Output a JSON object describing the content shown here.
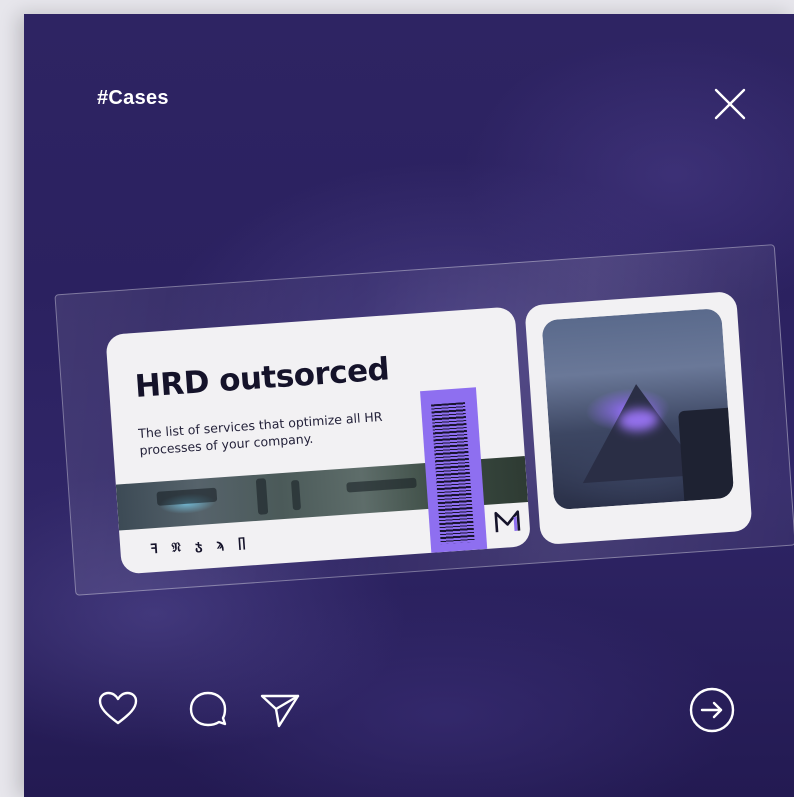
{
  "post": {
    "tag": "#Cases",
    "card": {
      "title": "HRD outsorced",
      "description": "The list of services that optimize all HR processes of your company.",
      "brand_glyphs": "ꟻ 𝔑 ჯ ϡ ∏",
      "logo_letter": "M",
      "accent_color": "#8e6ff0"
    }
  },
  "icons": {
    "close": "close-icon",
    "like": "heart-icon",
    "comment": "comment-icon",
    "share": "send-icon",
    "next": "arrow-right-circle-icon"
  },
  "colors": {
    "background": "#2e2463",
    "frame": "#e7e6ec",
    "card": "#f2f1f3",
    "text_light": "#ffffff",
    "text_dark": "#15132a"
  }
}
